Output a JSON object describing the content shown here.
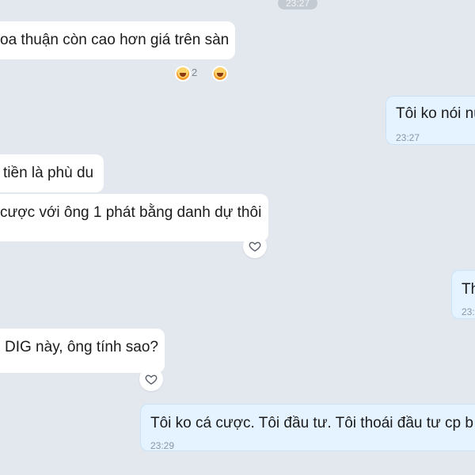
{
  "top_timestamp": "23:27",
  "messages": [
    {
      "text": "oa thuận còn cao hơn giá trên sàn",
      "reaction_count": "2"
    },
    {
      "text": "Tôi ko nói nư",
      "time": "23:27"
    },
    {
      "text": "tiền là phù du"
    },
    {
      "text": "cược với ông 1 phát bằng danh dự thôi"
    },
    {
      "text": "Th",
      "time": "23:"
    },
    {
      "text": "DIG này, ông tính sao?"
    },
    {
      "text": "Tôi ko cá cược. Tôi đầu tư. Tôi thoái đầu tư cp b",
      "time": "23:29"
    }
  ],
  "icons": {
    "reaction": "laughing-face-icon",
    "like": "heart-outline-icon"
  }
}
